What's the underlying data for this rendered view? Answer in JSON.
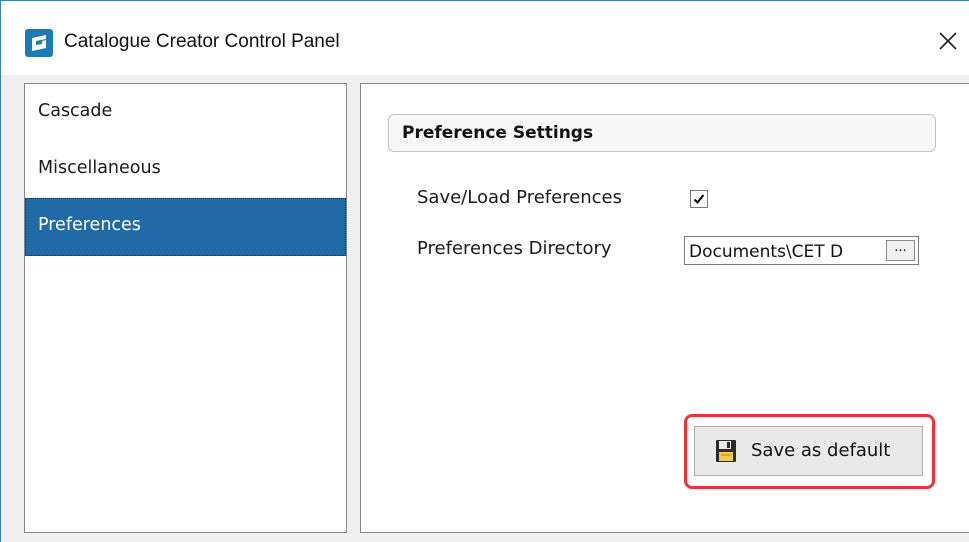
{
  "window": {
    "title": "Catalogue Creator Control Panel",
    "close_glyph": "×"
  },
  "sidebar": {
    "items": [
      {
        "label": "Cascade",
        "selected": false
      },
      {
        "label": "Miscellaneous",
        "selected": false
      },
      {
        "label": "Preferences",
        "selected": true
      }
    ]
  },
  "main": {
    "section_title": "Preference Settings",
    "save_load_label": "Save/Load Preferences",
    "save_load_checked": true,
    "directory_label": "Preferences Directory",
    "directory_value": "Documents\\CET D",
    "browse_label": "...",
    "save_default_label": "Save as default"
  },
  "colors": {
    "accent": "#1f6aa7",
    "highlight": "#e8343a"
  },
  "icons": {
    "app": "catalogue-creator-app-icon",
    "close": "close-icon",
    "checkbox": "checkmark-icon",
    "save": "floppy-disk-icon"
  }
}
